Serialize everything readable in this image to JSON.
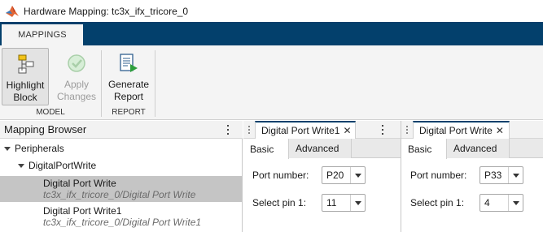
{
  "window": {
    "title": "Hardware Mapping: tc3x_ifx_tricore_0",
    "logo_icon": "matlab-logo-icon"
  },
  "ribbon": {
    "tabs": [
      {
        "label": "MAPPINGS"
      }
    ],
    "groups": [
      {
        "label": "MODEL",
        "buttons": [
          {
            "label_line1": "Highlight",
            "label_line2": "Block",
            "icon": "highlight-block-icon",
            "enabled": true
          },
          {
            "label_line1": "Apply",
            "label_line2": "Changes",
            "icon": "check-circle-icon",
            "enabled": false
          }
        ]
      },
      {
        "label": "REPORT",
        "buttons": [
          {
            "label_line1": "Generate",
            "label_line2": "Report",
            "icon": "generate-report-icon",
            "enabled": true
          }
        ]
      }
    ]
  },
  "browser": {
    "title": "Mapping Browser",
    "tree": {
      "root": "Peripherals",
      "child": "DigitalPortWrite",
      "items": [
        {
          "name": "Digital Port Write",
          "path": "tc3x_ifx_tricore_0/Digital Port Write",
          "selected": true
        },
        {
          "name": "Digital Port Write1",
          "path": "tc3x_ifx_tricore_0/Digital Port Write1",
          "selected": false
        }
      ]
    }
  },
  "panels": [
    {
      "doc_tab": "Digital Port Write1",
      "close": "✕",
      "tabs": [
        "Basic",
        "Advanced"
      ],
      "active_tab": "Basic",
      "fields": [
        {
          "label": "Port number:",
          "value": "P20"
        },
        {
          "label": "Select pin 1:",
          "value": "11"
        }
      ]
    },
    {
      "doc_tab": "Digital Port Write",
      "close": "✕",
      "tabs": [
        "Basic",
        "Advanced"
      ],
      "active_tab": "Basic",
      "fields": [
        {
          "label": "Port number:",
          "value": "P33"
        },
        {
          "label": "Select pin 1:",
          "value": "4"
        }
      ]
    }
  ],
  "colors": {
    "accent": "#03406c",
    "toolstrip": "#f4f4f4",
    "selection": "#c5c5c5"
  }
}
